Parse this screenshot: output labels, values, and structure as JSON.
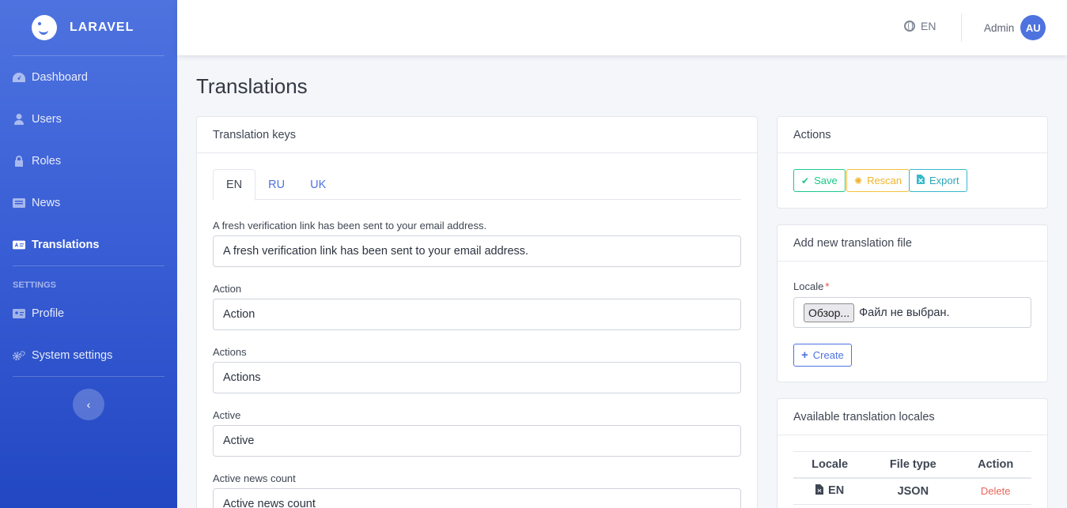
{
  "sidebar": {
    "brand": "LARAVEL",
    "items": [
      {
        "label": "Dashboard",
        "icon": "gauge-icon"
      },
      {
        "label": "Users",
        "icon": "user-icon"
      },
      {
        "label": "Roles",
        "icon": "lock-icon"
      },
      {
        "label": "News",
        "icon": "newspaper-icon"
      },
      {
        "label": "Translations",
        "icon": "language-icon",
        "active": true
      }
    ],
    "settings_heading": "SETTINGS",
    "settings_items": [
      {
        "label": "Profile",
        "icon": "id-card-icon"
      },
      {
        "label": "System settings",
        "icon": "cogs-icon"
      }
    ],
    "toggle_icon": "chevron-left-icon"
  },
  "topbar": {
    "language": "EN",
    "user_name": "Admin",
    "avatar_initials": "AU"
  },
  "page": {
    "title": "Translations"
  },
  "keys_card": {
    "title": "Translation keys",
    "tabs": [
      "EN",
      "RU",
      "UK"
    ],
    "active_tab": "EN",
    "fields": [
      {
        "label": "A fresh verification link has been sent to your email address.",
        "value": "A fresh verification link has been sent to your email address."
      },
      {
        "label": "Action",
        "value": "Action"
      },
      {
        "label": "Actions",
        "value": "Actions"
      },
      {
        "label": "Active",
        "value": "Active"
      },
      {
        "label": "Active news count",
        "value": "Active news count"
      }
    ]
  },
  "actions_card": {
    "title": "Actions",
    "save": "Save",
    "rescan": "Rescan",
    "export": "Export"
  },
  "add_file_card": {
    "title": "Add new translation file",
    "locale_label": "Locale",
    "required_mark": "*",
    "file_button": "Обзор...",
    "file_status": "Файл не выбран.",
    "create": "Create"
  },
  "locales_card": {
    "title": "Available translation locales",
    "columns": [
      "Locale",
      "File type",
      "Action"
    ],
    "rows": [
      {
        "locale": "EN",
        "file_type": "JSON",
        "action": "Delete"
      }
    ]
  },
  "colors": {
    "primary": "#4e73df",
    "success": "#1cc88a",
    "warning": "#f6c23e",
    "info": "#36b9cc",
    "danger": "#e74a3b"
  }
}
